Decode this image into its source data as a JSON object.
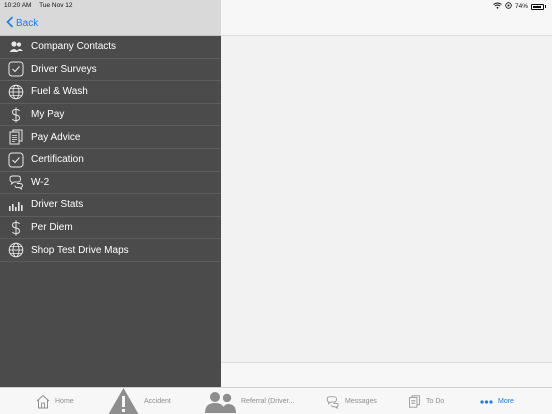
{
  "status": {
    "time": "10:20 AM",
    "date": "Tue Nov 12",
    "battery": "74%"
  },
  "nav": {
    "back_label": "Back"
  },
  "menu": [
    {
      "label": "Company Contacts",
      "icon": "contacts-icon"
    },
    {
      "label": "Driver Surveys",
      "icon": "checkmark-icon"
    },
    {
      "label": "Fuel & Wash",
      "icon": "globe-icon"
    },
    {
      "label": "My Pay",
      "icon": "dollar-icon"
    },
    {
      "label": "Pay Advice",
      "icon": "document-icon"
    },
    {
      "label": "Certification",
      "icon": "checkmark-icon"
    },
    {
      "label": "W-2",
      "icon": "chat-bubbles-icon"
    },
    {
      "label": "Driver Stats",
      "icon": "bar-chart-icon"
    },
    {
      "label": "Per Diem",
      "icon": "dollar-icon"
    },
    {
      "label": "Shop Test Drive Maps",
      "icon": "globe-icon"
    }
  ],
  "tabs": [
    {
      "label": "Home",
      "icon": "home-icon",
      "active": false
    },
    {
      "label": "Accident",
      "icon": "warning-icon",
      "active": false
    },
    {
      "label": "Referral (Driver...",
      "icon": "people-icon",
      "active": false
    },
    {
      "label": "Messages",
      "icon": "chat-bubbles-icon",
      "active": false
    },
    {
      "label": "To Do",
      "icon": "document-icon",
      "active": false
    },
    {
      "label": "More",
      "icon": "more-dots-icon",
      "active": true
    }
  ],
  "colors": {
    "accent": "#1a7cf5",
    "sidebar_bg": "#4b4b4b",
    "header_bg": "#d9d9d9"
  }
}
